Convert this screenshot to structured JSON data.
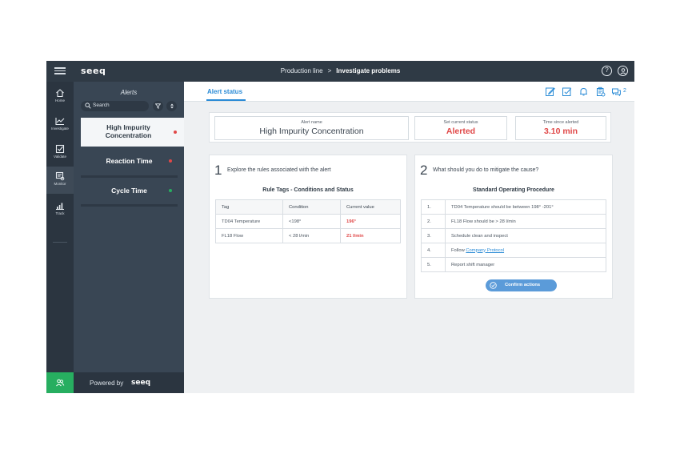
{
  "topbar": {
    "logo": "seeq",
    "breadcrumb_root": "Production line",
    "breadcrumb_sep": ">",
    "breadcrumb_current": "Investigate problems"
  },
  "rail": {
    "items": [
      {
        "label": "Home",
        "icon": "home-icon"
      },
      {
        "label": "Investigate",
        "icon": "chart-line-icon"
      },
      {
        "label": "Validate",
        "icon": "checkbox-icon"
      },
      {
        "label": "Monitor",
        "icon": "monitor-icon"
      },
      {
        "label": "Track",
        "icon": "bar-chart-icon"
      }
    ],
    "bottom_icon": "users-icon"
  },
  "alerts_panel": {
    "title": "Alerts",
    "search_placeholder": "Search",
    "items": [
      {
        "line1": "High Impurity",
        "line2": "Concentration",
        "status_color": "#e04848"
      },
      {
        "label": "Reaction Time",
        "status_color": "#e04848"
      },
      {
        "label": "Cycle Time",
        "status_color": "#27ae60"
      }
    ],
    "powered_by": "Powered by",
    "powered_logo": "seeq"
  },
  "main": {
    "tab": "Alert status",
    "chat_count": "2",
    "summary": {
      "alert_name_label": "Alert name",
      "alert_name": "High Impurity Concentration",
      "status_label": "Set current status",
      "status": "Alerted",
      "time_label": "Time since alerted",
      "time": "3.10 min"
    },
    "card1": {
      "number": "1",
      "question": "Explore the rules associated with the alert",
      "title": "Rule Tags - Conditions and Status",
      "headers": [
        "Tag",
        "Condition",
        "Current value"
      ],
      "rows": [
        [
          "TD04 Temperature",
          "<198°",
          "196°"
        ],
        [
          "FL18 Flow",
          "< 28 l/min",
          "21 l/min"
        ]
      ]
    },
    "card2": {
      "number": "2",
      "question": "What should you do to mitigate the cause?",
      "title": "Standard Operating Procedure",
      "steps": [
        {
          "n": "1.",
          "text": "TD04 Temperature should be between  198° -201°"
        },
        {
          "n": "2.",
          "text": "FL18 Flow should be > 28 l/min"
        },
        {
          "n": "3.",
          "text": "Schedule clean and inspect"
        },
        {
          "n": "4.",
          "text": "Follow ",
          "link": "Company Protocol"
        },
        {
          "n": "5.",
          "text": "Report shift manager"
        }
      ],
      "confirm_label": "Confirm actions"
    }
  },
  "colors": {
    "accent": "#2a8bd6",
    "alert_red": "#e04848",
    "ok_green": "#27ae60",
    "dark": "#2f3a45"
  }
}
